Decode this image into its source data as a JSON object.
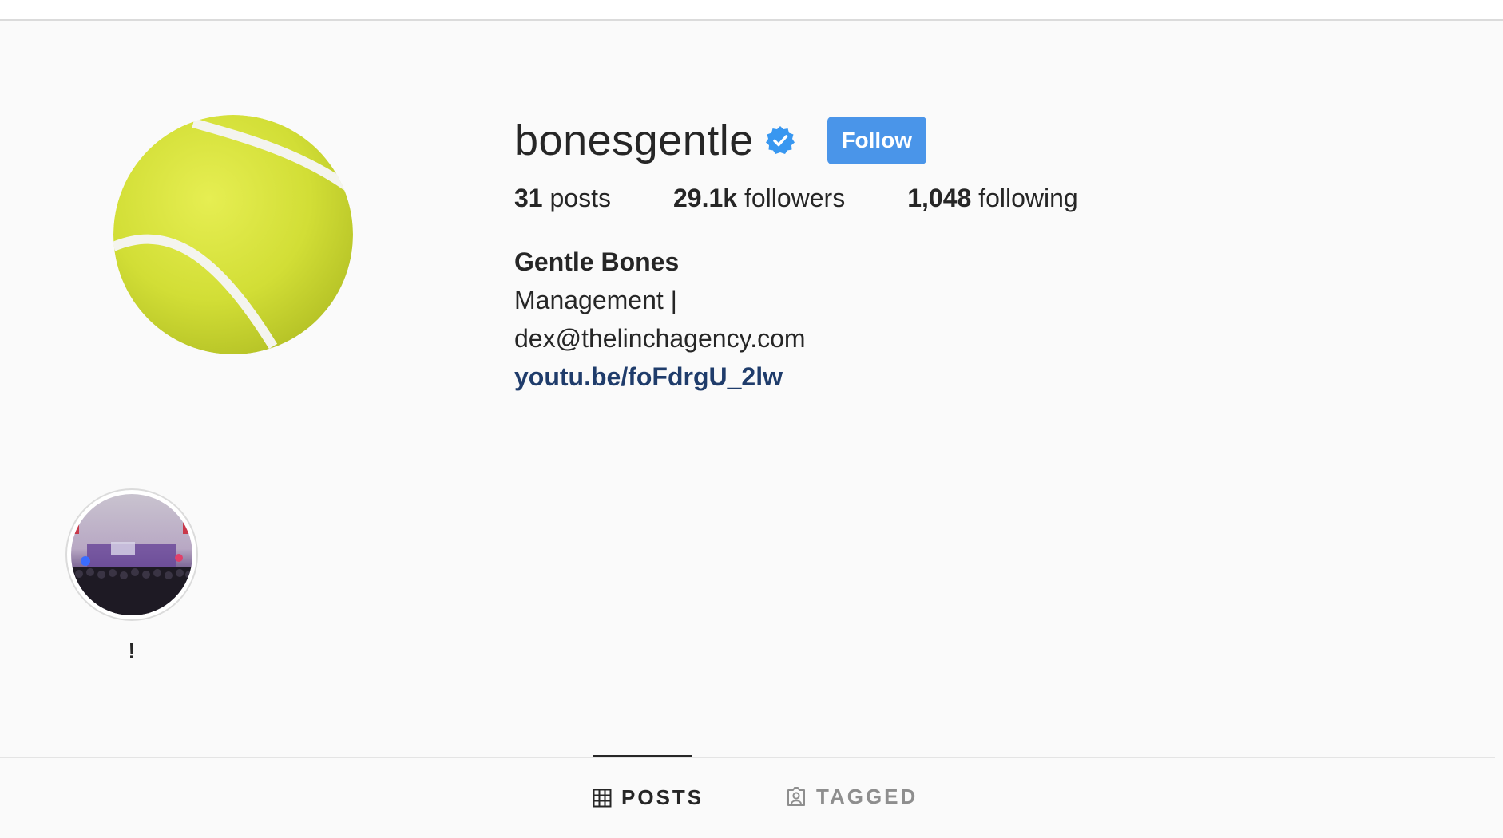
{
  "profile": {
    "username": "bonesgentle",
    "verified": true,
    "follow_label": "Follow",
    "stats": [
      {
        "value": "31",
        "label": "posts"
      },
      {
        "value": "29.1k",
        "label": "followers"
      },
      {
        "value": "1,048",
        "label": "following"
      }
    ],
    "bio": {
      "name": "Gentle Bones",
      "line1": "Management |",
      "line2": "dex@thelinchagency.com",
      "link": "youtu.be/foFdrgU_2lw"
    }
  },
  "highlights": [
    {
      "label": "!"
    }
  ],
  "tabs": [
    {
      "label": "POSTS",
      "icon": "grid-icon",
      "active": true
    },
    {
      "label": "TAGGED",
      "icon": "tagged-icon",
      "active": false
    }
  ],
  "colors": {
    "follow_button": "#4a95e9",
    "verified_badge": "#3897f0",
    "link": "#1f3c6b",
    "background": "#fafafa"
  }
}
